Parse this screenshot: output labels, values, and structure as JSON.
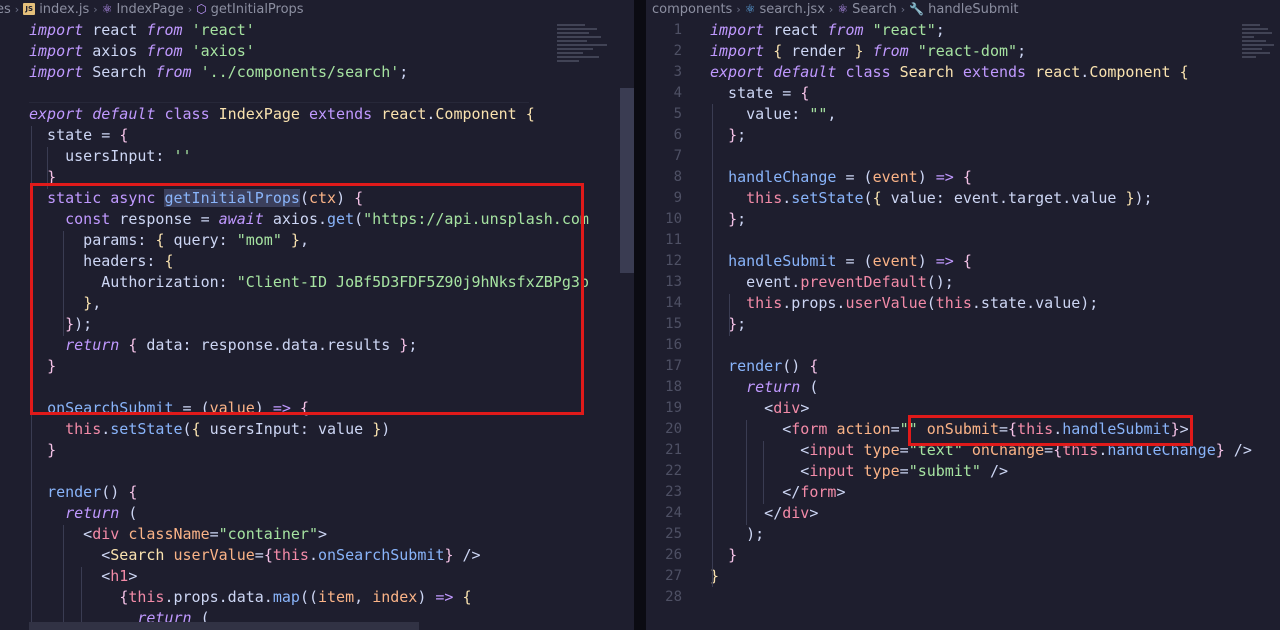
{
  "left": {
    "breadcrumb": [
      "es",
      "index.js",
      "IndexPage",
      "getInitialProps"
    ],
    "lines": [
      "import react from 'react'",
      "import axios from 'axios'",
      "import Search from '../components/search';",
      "",
      "export default class IndexPage extends react.Component {",
      "  state = {",
      "    usersInput: ''",
      "  }",
      "  static async getInitialProps(ctx) {",
      "    const response = await axios.get(\"https://api.unsplash.com",
      "      params: { query: \"mom\" },",
      "      headers: {",
      "        Authorization: \"Client-ID JoBf5D3FDF5Z90j9hNksfxZBPg3p",
      "      },",
      "    });",
      "    return { data: response.data.results };",
      "  }",
      "",
      "  onSearchSubmit = (value) => {",
      "    this.setState({ usersInput: value })",
      "  }",
      "",
      "  render() {",
      "    return (",
      "      <div className=\"container\">",
      "        <Search userValue={this.onSearchSubmit} />",
      "        <h1>",
      "          {this.props.data.map((item, index) => {",
      "            return ("
    ]
  },
  "right": {
    "breadcrumb": [
      "components",
      "search.jsx",
      "Search",
      "handleSubmit"
    ],
    "line_numbers": [
      "1",
      "2",
      "3",
      "4",
      "5",
      "6",
      "7",
      "8",
      "9",
      "10",
      "11",
      "12",
      "13",
      "14",
      "15",
      "16",
      "17",
      "18",
      "19",
      "20",
      "21",
      "22",
      "23",
      "24",
      "25",
      "26",
      "27",
      "28"
    ],
    "lines": [
      "import react from \"react\";",
      "import { render } from \"react-dom\";",
      "export default class Search extends react.Component {",
      "  state = {",
      "    value: \"\",",
      "  };",
      "",
      "  handleChange = (event) => {",
      "    this.setState({ value: event.target.value });",
      "  };",
      "",
      "  handleSubmit = (event) => {",
      "    event.preventDefault();",
      "    this.props.userValue(this.state.value);",
      "  };",
      "",
      "  render() {",
      "    return (",
      "      <div>",
      "        <form action=\"\" onSubmit={this.handleSubmit}>",
      "          <input type=\"text\" onChange={this.handleChange} />",
      "          <input type=\"submit\" />",
      "        </form>",
      "      </div>",
      "    );",
      "  }",
      "}",
      ""
    ]
  },
  "colors": {
    "background": "#1e1e2e",
    "annotation_red": "#e01a1a",
    "keyword": "#c099ff",
    "string": "#a6e3a1",
    "function": "#89b4fa",
    "class": "#f9e2af"
  },
  "icons": [
    "chevron-right-icon",
    "js-file-icon",
    "react-component-icon",
    "cube-icon",
    "wrench-icon",
    "react-file-icon"
  ]
}
